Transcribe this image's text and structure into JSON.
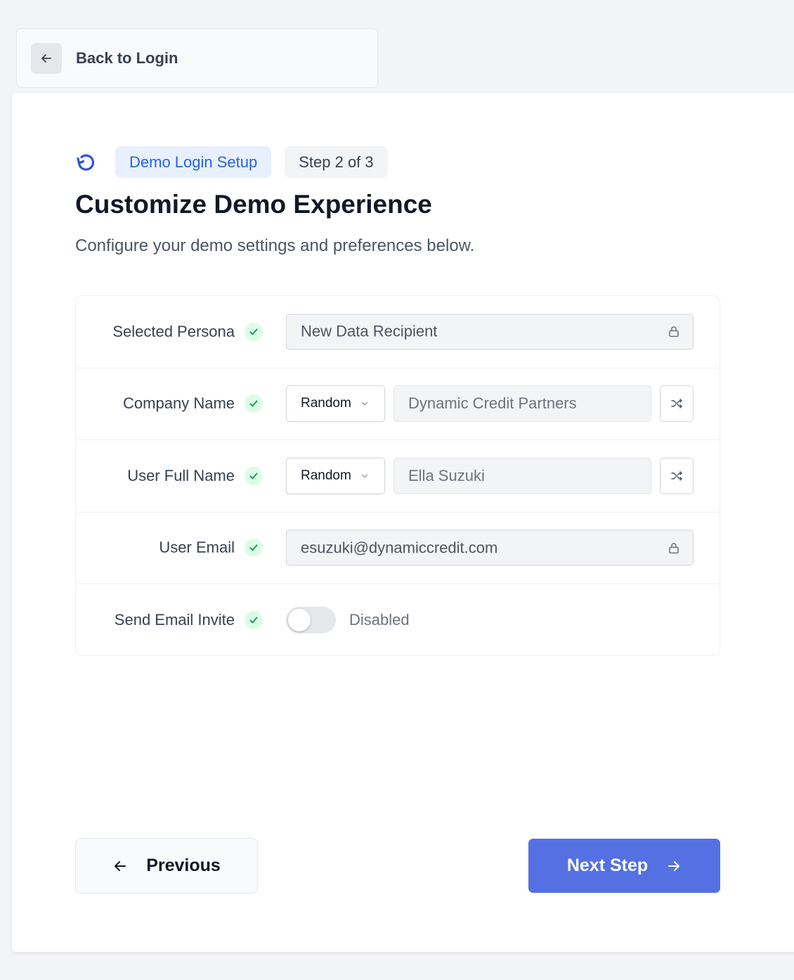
{
  "back": {
    "label": "Back to Login"
  },
  "header": {
    "badge": "Demo Login Setup",
    "step": "Step 2 of 3",
    "title": "Customize Demo Experience",
    "subtitle": "Configure your demo settings and preferences below."
  },
  "form": {
    "persona": {
      "label": "Selected Persona",
      "value": "New Data Recipient",
      "locked": true
    },
    "company": {
      "label": "Company Name",
      "mode": "Random",
      "value": "Dynamic Credit Partners"
    },
    "user_name": {
      "label": "User Full Name",
      "mode": "Random",
      "value": "Ella Suzuki"
    },
    "email": {
      "label": "User Email",
      "value": "esuzuki@dynamiccredit.com",
      "locked": true
    },
    "invite": {
      "label": "Send Email Invite",
      "status": "Disabled",
      "enabled": false
    }
  },
  "footer": {
    "previous_label": "Previous",
    "next_label": "Next Step"
  },
  "colors": {
    "primary": "#5570e3",
    "badge_text": "#2563eb",
    "check": "#16a34a"
  },
  "icons": {
    "back": "arrow-left-icon",
    "spinner": "refresh-icon",
    "check": "check-circle-icon",
    "lock": "lock-icon",
    "chevron": "chevron-down-icon",
    "shuffle": "shuffle-icon",
    "next": "arrow-right-icon"
  }
}
